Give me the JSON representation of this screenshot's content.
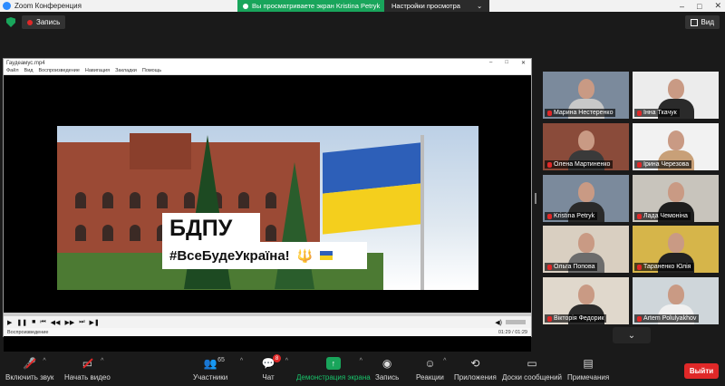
{
  "window": {
    "title": "Zoom Конференция",
    "share_banner": "Вы просматриваете экран Kristina Petryk",
    "view_settings": "Настройки просмотра",
    "controls": [
      "–",
      "□",
      "✕"
    ]
  },
  "topbar": {
    "record_label": "Запись",
    "view_label": "Вид"
  },
  "player": {
    "file_title": "Гаудеамус.mp4",
    "menu": [
      "Файл",
      "Вид",
      "Воспроизведение",
      "Навигация",
      "Закладки",
      "Помощь"
    ],
    "status_left": "Воспроизведение",
    "time": "01:29 / 01:29",
    "frame_text_title": "БДПУ",
    "frame_text_tag": "#ВсеБудеУкраїна!",
    "trident": "🔱"
  },
  "participants": [
    {
      "name": "Марина Нестеренко",
      "active": true,
      "bg": "#7b8a9c",
      "shirt": "#c8c8c8"
    },
    {
      "name": "Інна Ткачук",
      "active": false,
      "bg": "#ececec",
      "shirt": "#2a2a2a"
    },
    {
      "name": "Олена Мартиненко",
      "active": false,
      "bg": "#8a4b3a",
      "shirt": "#3a3a3a"
    },
    {
      "name": "Ірина Черезова",
      "active": false,
      "bg": "#f2f2f2",
      "shirt": "#c8a078"
    },
    {
      "name": "Kristina Petryk",
      "active": false,
      "bg": "#7b8a9c",
      "shirt": "#2a2a2a"
    },
    {
      "name": "Лада Чемоніна",
      "active": false,
      "bg": "#c8c4bc",
      "shirt": "#1e1e1e"
    },
    {
      "name": "Ольга Попова",
      "active": false,
      "bg": "#d9cfc1",
      "shirt": "#6c6c6c"
    },
    {
      "name": "Тараненко Юлія",
      "active": false,
      "bg": "#d6b54a",
      "shirt": "#222222"
    },
    {
      "name": "Вікторія Федорик",
      "active": false,
      "bg": "#e0d8cc",
      "shirt": "#2b2b2b"
    },
    {
      "name": "Artem Polulyakhov",
      "active": false,
      "bg": "#cfd6da",
      "shirt": "#f0f0f0"
    }
  ],
  "toolbar": {
    "mute": "Включить звук",
    "video": "Начать видео",
    "participants": "Участники",
    "participants_count": "65",
    "chat": "Чат",
    "chat_badge": "8",
    "share": "Демонстрация экрана",
    "record": "Запись",
    "reactions": "Реакции",
    "apps": "Приложения",
    "whiteboards": "Доски сообщений",
    "notes": "Примечания",
    "leave": "Выйти"
  },
  "colors": {
    "share_green": "#19a55b",
    "leave_red": "#e02828",
    "active_speaker": "#f5d53c"
  }
}
